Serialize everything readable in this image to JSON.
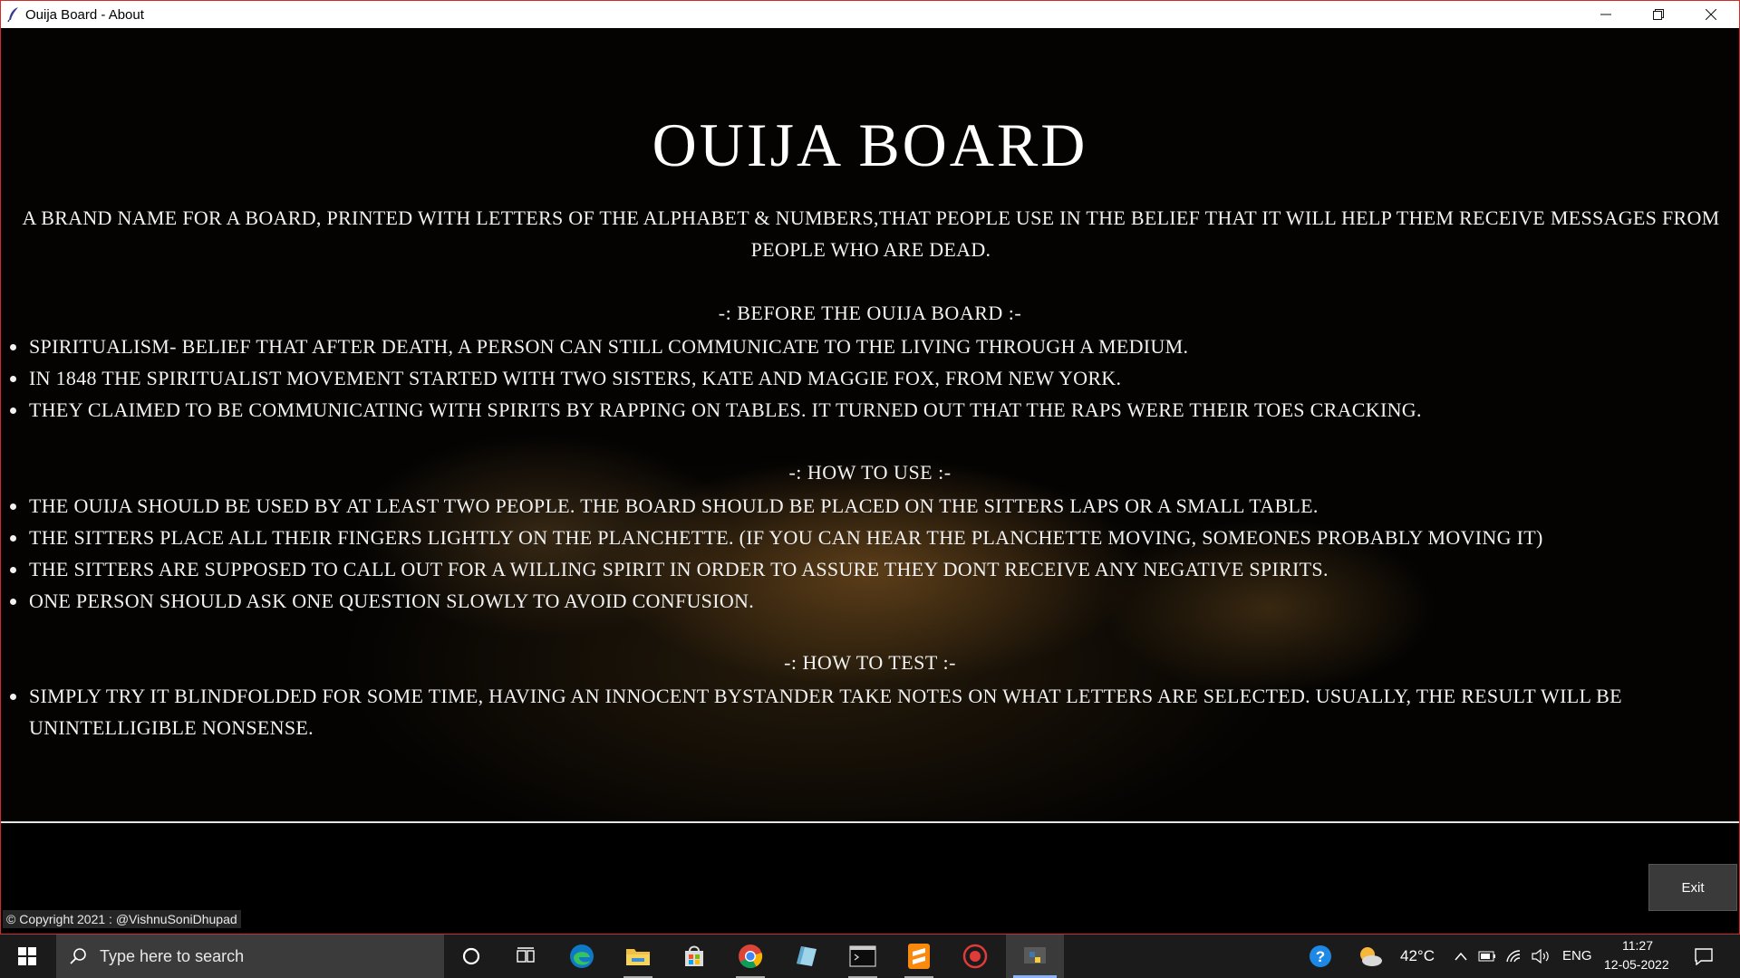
{
  "window": {
    "title": "Ouija Board - About",
    "controls": {
      "minimize": "—",
      "restore": "❐",
      "close": "✕"
    }
  },
  "about": {
    "heading": "OUIJA BOARD",
    "intro": "A BRAND NAME FOR A BOARD, PRINTED WITH LETTERS OF THE ALPHABET & NUMBERS,THAT PEOPLE USE IN THE BELIEF THAT IT WILL HELP THEM RECEIVE MESSAGES FROM PEOPLE WHO ARE DEAD.",
    "sections": [
      {
        "heading": "-: BEFORE THE OUIJA BOARD :-",
        "items": [
          "SPIRITUALISM- BELIEF THAT AFTER DEATH, A PERSON CAN STILL COMMUNICATE TO THE LIVING THROUGH A MEDIUM.",
          "IN 1848 THE SPIRITUALIST MOVEMENT STARTED WITH TWO SISTERS, KATE AND MAGGIE FOX, FROM NEW YORK.",
          "THEY CLAIMED TO BE COMMUNICATING WITH SPIRITS BY RAPPING ON TABLES. IT TURNED OUT THAT THE RAPS WERE THEIR TOES CRACKING."
        ]
      },
      {
        "heading": "-: HOW TO USE :-",
        "items": [
          "THE OUIJA SHOULD BE USED BY AT LEAST TWO PEOPLE. THE BOARD SHOULD BE PLACED ON THE SITTERS LAPS OR A SMALL TABLE.",
          "THE SITTERS PLACE ALL THEIR FINGERS LIGHTLY ON THE PLANCHETTE. (IF YOU CAN HEAR THE PLANCHETTE MOVING, SOMEONES PROBABLY MOVING IT)",
          "THE SITTERS ARE SUPPOSED TO CALL OUT FOR A WILLING SPIRIT IN ORDER TO ASSURE THEY DONT RECEIVE ANY NEGATIVE SPIRITS.",
          "ONE PERSON SHOULD ASK ONE QUESTION SLOWLY TO AVOID CONFUSION."
        ]
      },
      {
        "heading": "-: HOW TO TEST :-",
        "items": [
          "SIMPLY TRY IT BLINDFOLDED FOR SOME TIME, HAVING AN INNOCENT BYSTANDER TAKE NOTES ON WHAT LETTERS ARE SELECTED. USUALLY, THE RESULT WILL BE UNINTELLIGIBLE NONSENSE."
        ]
      }
    ]
  },
  "footer": {
    "exit_label": "Exit",
    "copyright": "© Copyright 2021 : @VishnuSoniDhupad"
  },
  "taskbar": {
    "search_placeholder": "Type here to search",
    "weather": "42°C",
    "language": "ENG",
    "time": "11:27",
    "date": "12-05-2022",
    "pinned": [
      "cortana-icon",
      "task-view-icon",
      "edge-icon",
      "file-explorer-icon",
      "store-icon",
      "chrome-icon",
      "notes-icon",
      "terminal-icon",
      "sublime-text-icon",
      "recorder-icon",
      "python-icon"
    ]
  },
  "colors": {
    "window_border": "#d42a2a",
    "background": "#000000",
    "text": "#f2f2f2",
    "taskbar": "#1b1b1b"
  }
}
